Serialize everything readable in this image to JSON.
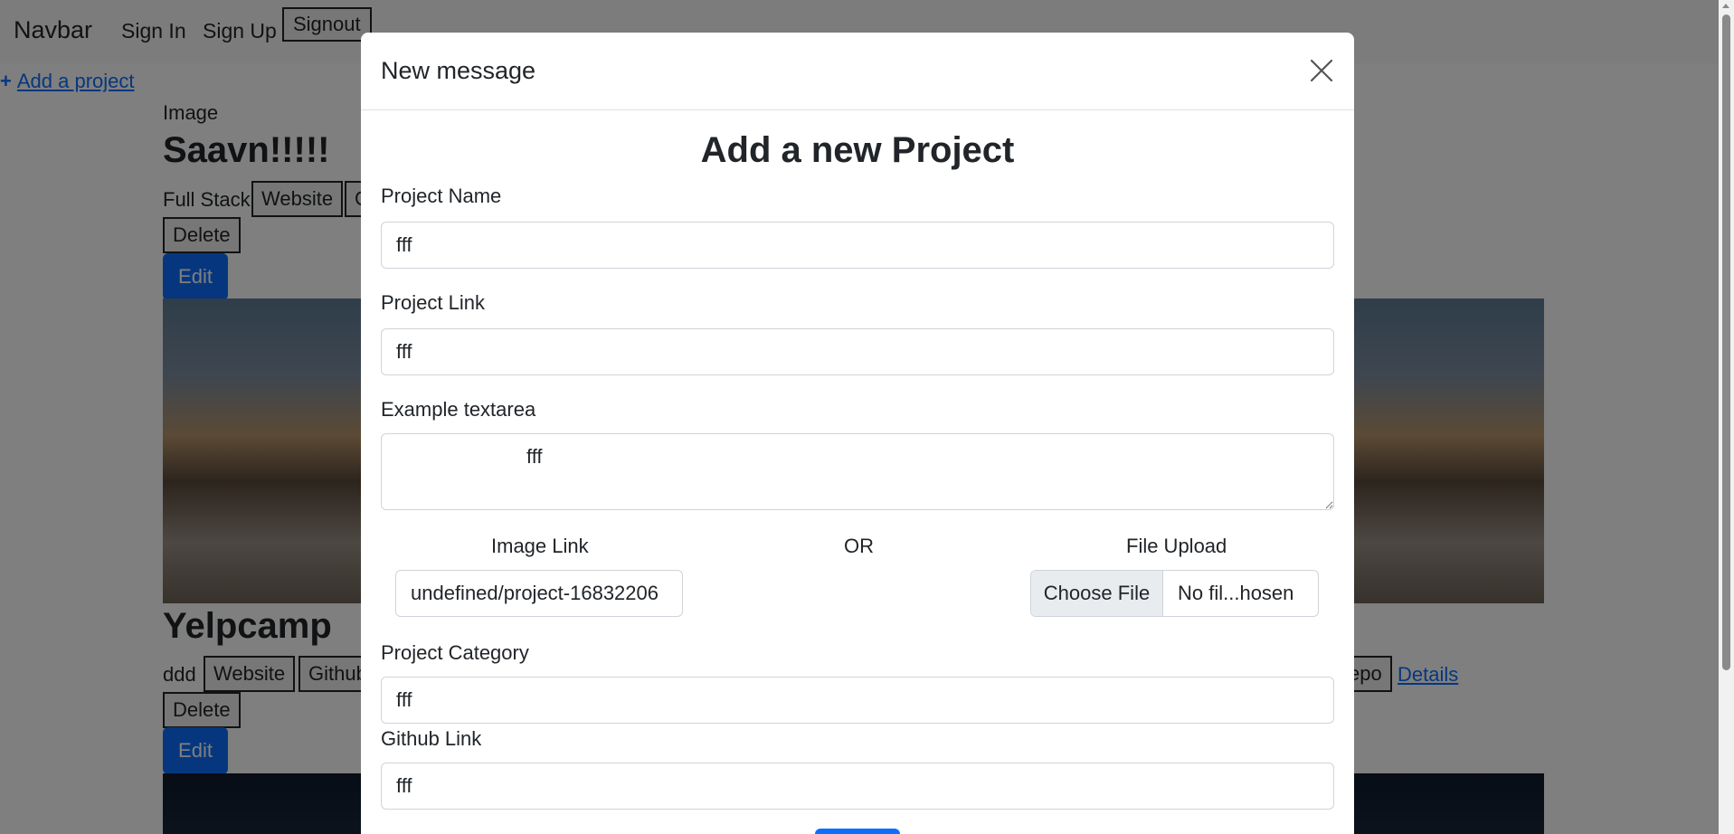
{
  "navbar": {
    "brand": "Navbar",
    "sign_in": "Sign In",
    "sign_up": "Sign Up",
    "signout": "Signout"
  },
  "add_project": "Add a project",
  "projects": [
    {
      "image_alt": "Image",
      "title": "Saavn!!!!!",
      "category": "Full Stack",
      "website_label": "Website",
      "github_label": "G",
      "delete_label": "Delete",
      "edit_label": "Edit"
    },
    {
      "title": "Yelpcamp",
      "category": "ddd",
      "website_label": "Website",
      "github_label": "Github",
      "repo_label": "epo",
      "details_label": "Details",
      "delete_label": "Delete",
      "edit_label": "Edit"
    }
  ],
  "modal": {
    "title": "New message",
    "heading": "Add a new Project",
    "project_name_label": "Project Name",
    "project_name_value": "fff",
    "project_link_label": "Project Link",
    "project_link_value": "fff",
    "textarea_label": "Example textarea",
    "textarea_value": "fff",
    "image_link_label": "Image Link",
    "or_label": "OR",
    "file_upload_label": "File Upload",
    "image_link_value": "undefined/project-16832206",
    "choose_file_label": "Choose File",
    "file_name": "No fil...hosen",
    "category_label": "Project Category",
    "category_value": "fff",
    "github_label": "Github Link",
    "github_value": "fff"
  }
}
